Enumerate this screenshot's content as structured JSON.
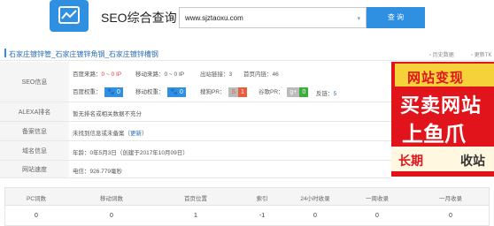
{
  "header": {
    "title": "SEO综合查询",
    "search_value": "www.sjztaoxu.com",
    "search_button": "查 询"
  },
  "site": {
    "name": "石家庄镀锌管_石家庄镀锌角钢_石家庄镀锌槽钢",
    "history_label": "历史数据",
    "side_label": "更新TK"
  },
  "seo": {
    "label": "SEO信息",
    "baidu_source": "百度来路：",
    "baidu_source_val": "0 ~ 0 IP",
    "mobile_source": "移动来路：",
    "mobile_source_val": "0 ~ 0 IP",
    "outlinks": "出站链接：",
    "outlinks_val": "3",
    "home_inlinks": "首页内链：",
    "home_inlinks_val": "46",
    "baidu_weight": "百度权重：",
    "baidu_weight_val": "0",
    "mobile_weight": "移动权重：",
    "mobile_weight_val": "0",
    "sogou_pr": "搜狗PR：",
    "sogou_pr_val": "1",
    "google_pr": "谷歌PR：",
    "google_pr_val": "0",
    "backlinks": "反链：",
    "backlinks_val": "5"
  },
  "alexa": {
    "label": "ALEXA排名",
    "value": "暂无排名或相关数据不充分"
  },
  "beian": {
    "label": "备案信息",
    "value": "未找到信息或未备案",
    "update": "更新"
  },
  "domain": {
    "label": "域名信息",
    "value": "年龄：0年5月3日（创建于2017年10月09日）"
  },
  "speed": {
    "label": "网站速度",
    "value": "电信：926.779毫秒"
  },
  "ad": {
    "top": "网站变现",
    "big": "买卖网站",
    "mid": "上鱼爪",
    "bottom1": "长期",
    "bottom2": "收站"
  },
  "stats": {
    "headers": [
      "PC词数",
      "移动词数",
      "首页位置",
      "索引",
      "24小时收录",
      "一周收录",
      "一月收录"
    ],
    "values": [
      "0",
      "0",
      "1",
      "-1",
      "0",
      "0",
      "0"
    ]
  },
  "colors": {
    "accent": "#2f8fe0",
    "red": "#e33333",
    "badge_green": "#3cae3c",
    "ad_red": "#e1141b"
  },
  "icons": {
    "logo": "chart-icon",
    "caret": "chevron-down-icon"
  }
}
